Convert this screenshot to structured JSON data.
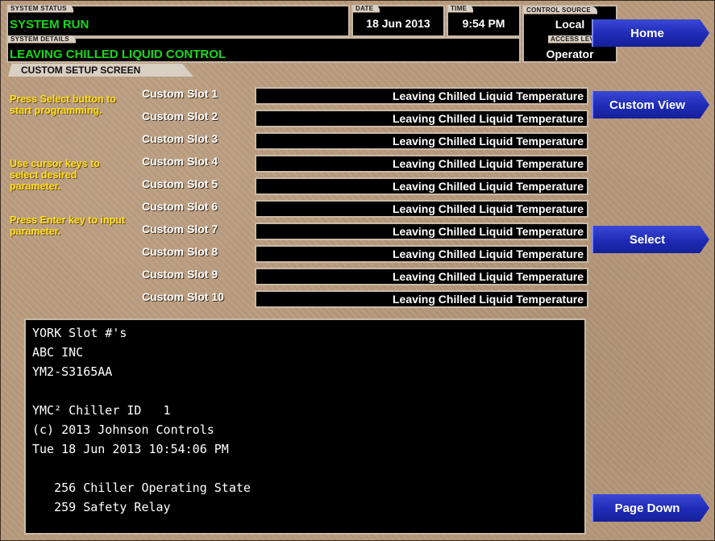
{
  "header": {
    "system_status_label": "SYSTEM STATUS",
    "system_status": "SYSTEM RUN",
    "system_details_label": "SYSTEM DETAILS",
    "system_details": "LEAVING CHILLED LIQUID CONTROL",
    "date_label": "DATE",
    "date": "18 Jun 2013",
    "time_label": "TIME",
    "time": "9:54 PM",
    "control_source_label": "CONTROL SOURCE",
    "control_source": "Local",
    "access_level_label": "ACCESS LEVEL",
    "access_level": "Operator"
  },
  "screen_title": "CUSTOM SETUP SCREEN",
  "instructions": {
    "p1": "Press Select button to start programming.",
    "p2": "Use cursor keys to select desired parameter.",
    "p3": "Press Enter key to input parameter."
  },
  "slots": [
    {
      "label": "Custom Slot 1",
      "value": "Leaving Chilled Liquid Temperature"
    },
    {
      "label": "Custom Slot 2",
      "value": "Leaving Chilled Liquid Temperature"
    },
    {
      "label": "Custom Slot 3",
      "value": "Leaving Chilled Liquid Temperature"
    },
    {
      "label": "Custom Slot 4",
      "value": "Leaving Chilled Liquid Temperature"
    },
    {
      "label": "Custom Slot 5",
      "value": "Leaving Chilled Liquid Temperature"
    },
    {
      "label": "Custom Slot 6",
      "value": "Leaving Chilled Liquid Temperature"
    },
    {
      "label": "Custom Slot 7",
      "value": "Leaving Chilled Liquid Temperature"
    },
    {
      "label": "Custom Slot 8",
      "value": "Leaving Chilled Liquid Temperature"
    },
    {
      "label": "Custom Slot 9",
      "value": "Leaving Chilled Liquid Temperature"
    },
    {
      "label": "Custom Slot 10",
      "value": "Leaving Chilled Liquid Temperature"
    }
  ],
  "console_lines": [
    "YORK Slot #'s",
    "ABC INC",
    "YM2-S3165AA",
    "",
    "YMC² Chiller ID   1",
    "(c) 2013 Johnson Controls",
    "Tue 18 Jun 2013 10:54:06 PM",
    "",
    "   256 Chiller Operating State",
    "   259 Safety Relay"
  ],
  "nav": {
    "home": "Home",
    "custom_view": "Custom View",
    "select": "Select",
    "page_down": "Page Down"
  },
  "colors": {
    "status_green": "#16d916",
    "instruction_yellow": "#ffe01a",
    "button_blue": "#1e2bb5",
    "background_tan": "#b89a7c"
  }
}
